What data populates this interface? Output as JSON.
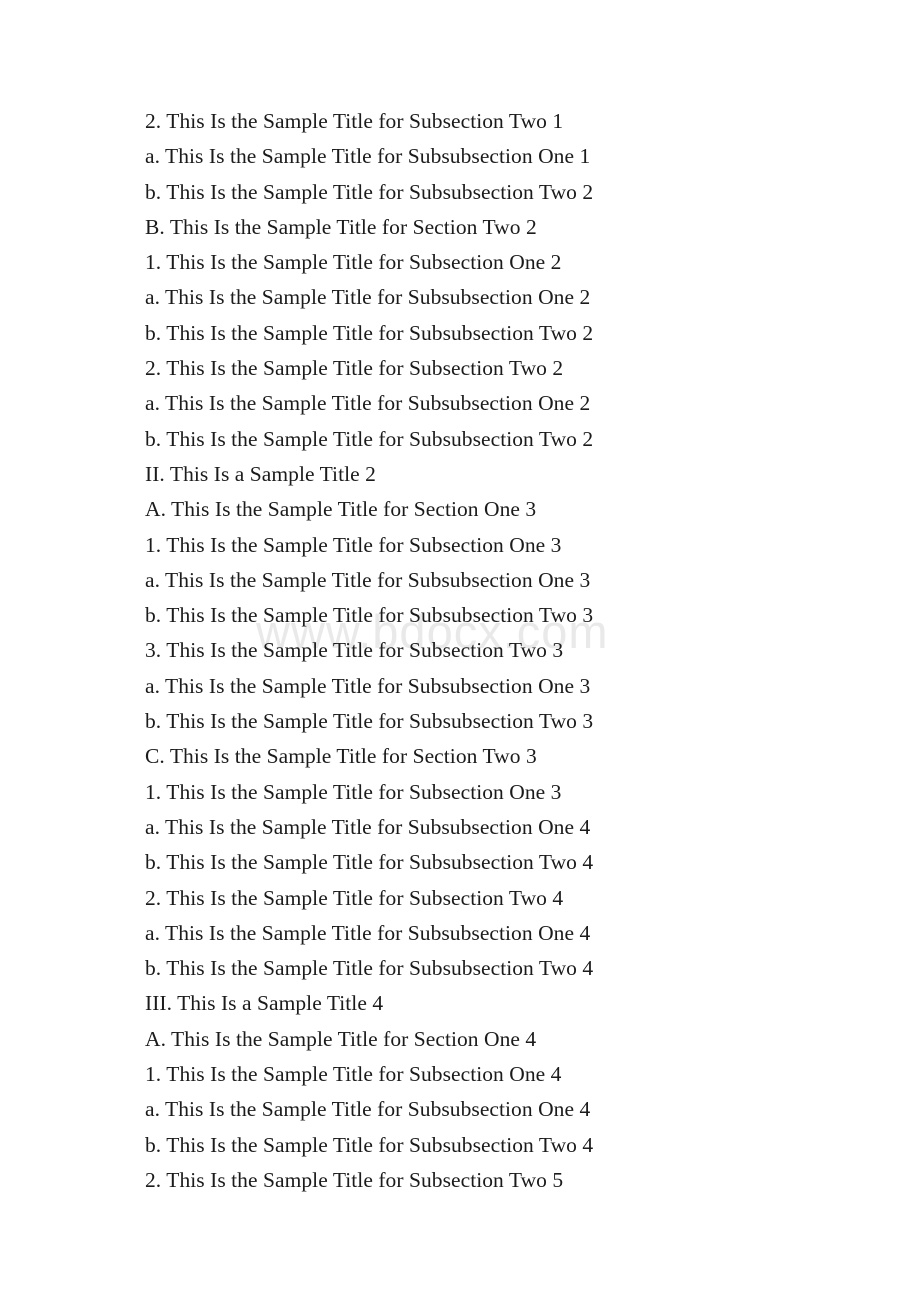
{
  "page": {
    "background_color": "#ffffff",
    "text_color": "#1b1b1b"
  },
  "watermark": {
    "text": "www.bdocx.com",
    "color": "#e9e9e9"
  },
  "outline": {
    "lines": [
      {
        "marker": "2.",
        "text": "2. This Is the Sample Title for Subsection Two 1"
      },
      {
        "marker": "a.",
        "text": "a. This Is the Sample Title for Subsubsection One 1"
      },
      {
        "marker": "b.",
        "text": "b. This Is the Sample Title for Subsubsection Two 2"
      },
      {
        "marker": "B.",
        "text": "B. This Is the Sample Title for Section Two 2"
      },
      {
        "marker": "1.",
        "text": "1. This Is the Sample Title for Subsection One 2"
      },
      {
        "marker": "a.",
        "text": "a. This Is the Sample Title for Subsubsection One 2"
      },
      {
        "marker": "b.",
        "text": "b. This Is the Sample Title for Subsubsection Two 2"
      },
      {
        "marker": "2.",
        "text": "2. This Is the Sample Title for Subsection Two 2"
      },
      {
        "marker": "a.",
        "text": "a. This Is the Sample Title for Subsubsection One 2"
      },
      {
        "marker": "b.",
        "text": "b. This Is the Sample Title for Subsubsection Two 2"
      },
      {
        "marker": "II.",
        "text": "II. This Is a Sample Title 2"
      },
      {
        "marker": "A.",
        "text": "A. This Is the Sample Title for Section One 3"
      },
      {
        "marker": "1.",
        "text": "1. This Is the Sample Title for Subsection One 3"
      },
      {
        "marker": "a.",
        "text": "a. This Is the Sample Title for Subsubsection One 3"
      },
      {
        "marker": "b.",
        "text": "b. This Is the Sample Title for Subsubsection Two 3"
      },
      {
        "marker": "3.",
        "text": "3. This Is the Sample Title for Subsection Two 3"
      },
      {
        "marker": "a.",
        "text": "a. This Is the Sample Title for Subsubsection One 3"
      },
      {
        "marker": "b.",
        "text": "b. This Is the Sample Title for Subsubsection Two 3"
      },
      {
        "marker": "C.",
        "text": "C. This Is the Sample Title for Section Two 3"
      },
      {
        "marker": "1.",
        "text": "1. This Is the Sample Title for Subsection One 3"
      },
      {
        "marker": "a.",
        "text": "a. This Is the Sample Title for Subsubsection One 4"
      },
      {
        "marker": "b.",
        "text": "b. This Is the Sample Title for Subsubsection Two 4"
      },
      {
        "marker": "2.",
        "text": "2. This Is the Sample Title for Subsection Two 4"
      },
      {
        "marker": "a.",
        "text": "a. This Is the Sample Title for Subsubsection One 4"
      },
      {
        "marker": "b.",
        "text": "b. This Is the Sample Title for Subsubsection Two 4"
      },
      {
        "marker": "III.",
        "text": "III. This Is a Sample Title 4"
      },
      {
        "marker": "A.",
        "text": "A. This Is the Sample Title for Section One 4"
      },
      {
        "marker": "1.",
        "text": "1. This Is the Sample Title for Subsection One 4"
      },
      {
        "marker": "a.",
        "text": "a. This Is the Sample Title for Subsubsection One 4"
      },
      {
        "marker": "b.",
        "text": "b. This Is the Sample Title for Subsubsection Two 4"
      },
      {
        "marker": "2.",
        "text": "2. This Is the Sample Title for Subsection Two 5"
      }
    ]
  }
}
